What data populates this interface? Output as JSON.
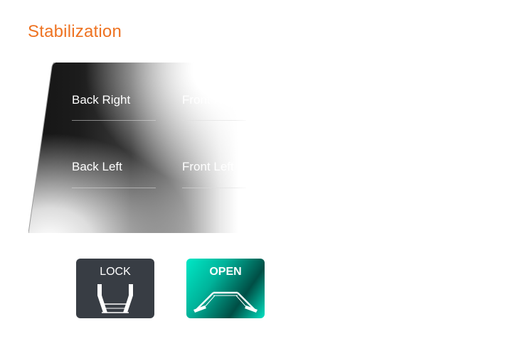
{
  "page": {
    "title": "Stabilization"
  },
  "stabilizers": {
    "back_right": "Back Right",
    "front_right": "Front Right",
    "back_left": "Back Left",
    "front_left": "Front Left"
  },
  "controls": {
    "lock_label": "LOCK",
    "open_label": "OPEN"
  },
  "colors": {
    "title": "#ee7322",
    "lock_button": "#383d44",
    "open_button_accent": "#00e8c6"
  },
  "icons": {
    "lock": "stabilizer-retracted-icon",
    "open": "stabilizer-extended-icon"
  }
}
